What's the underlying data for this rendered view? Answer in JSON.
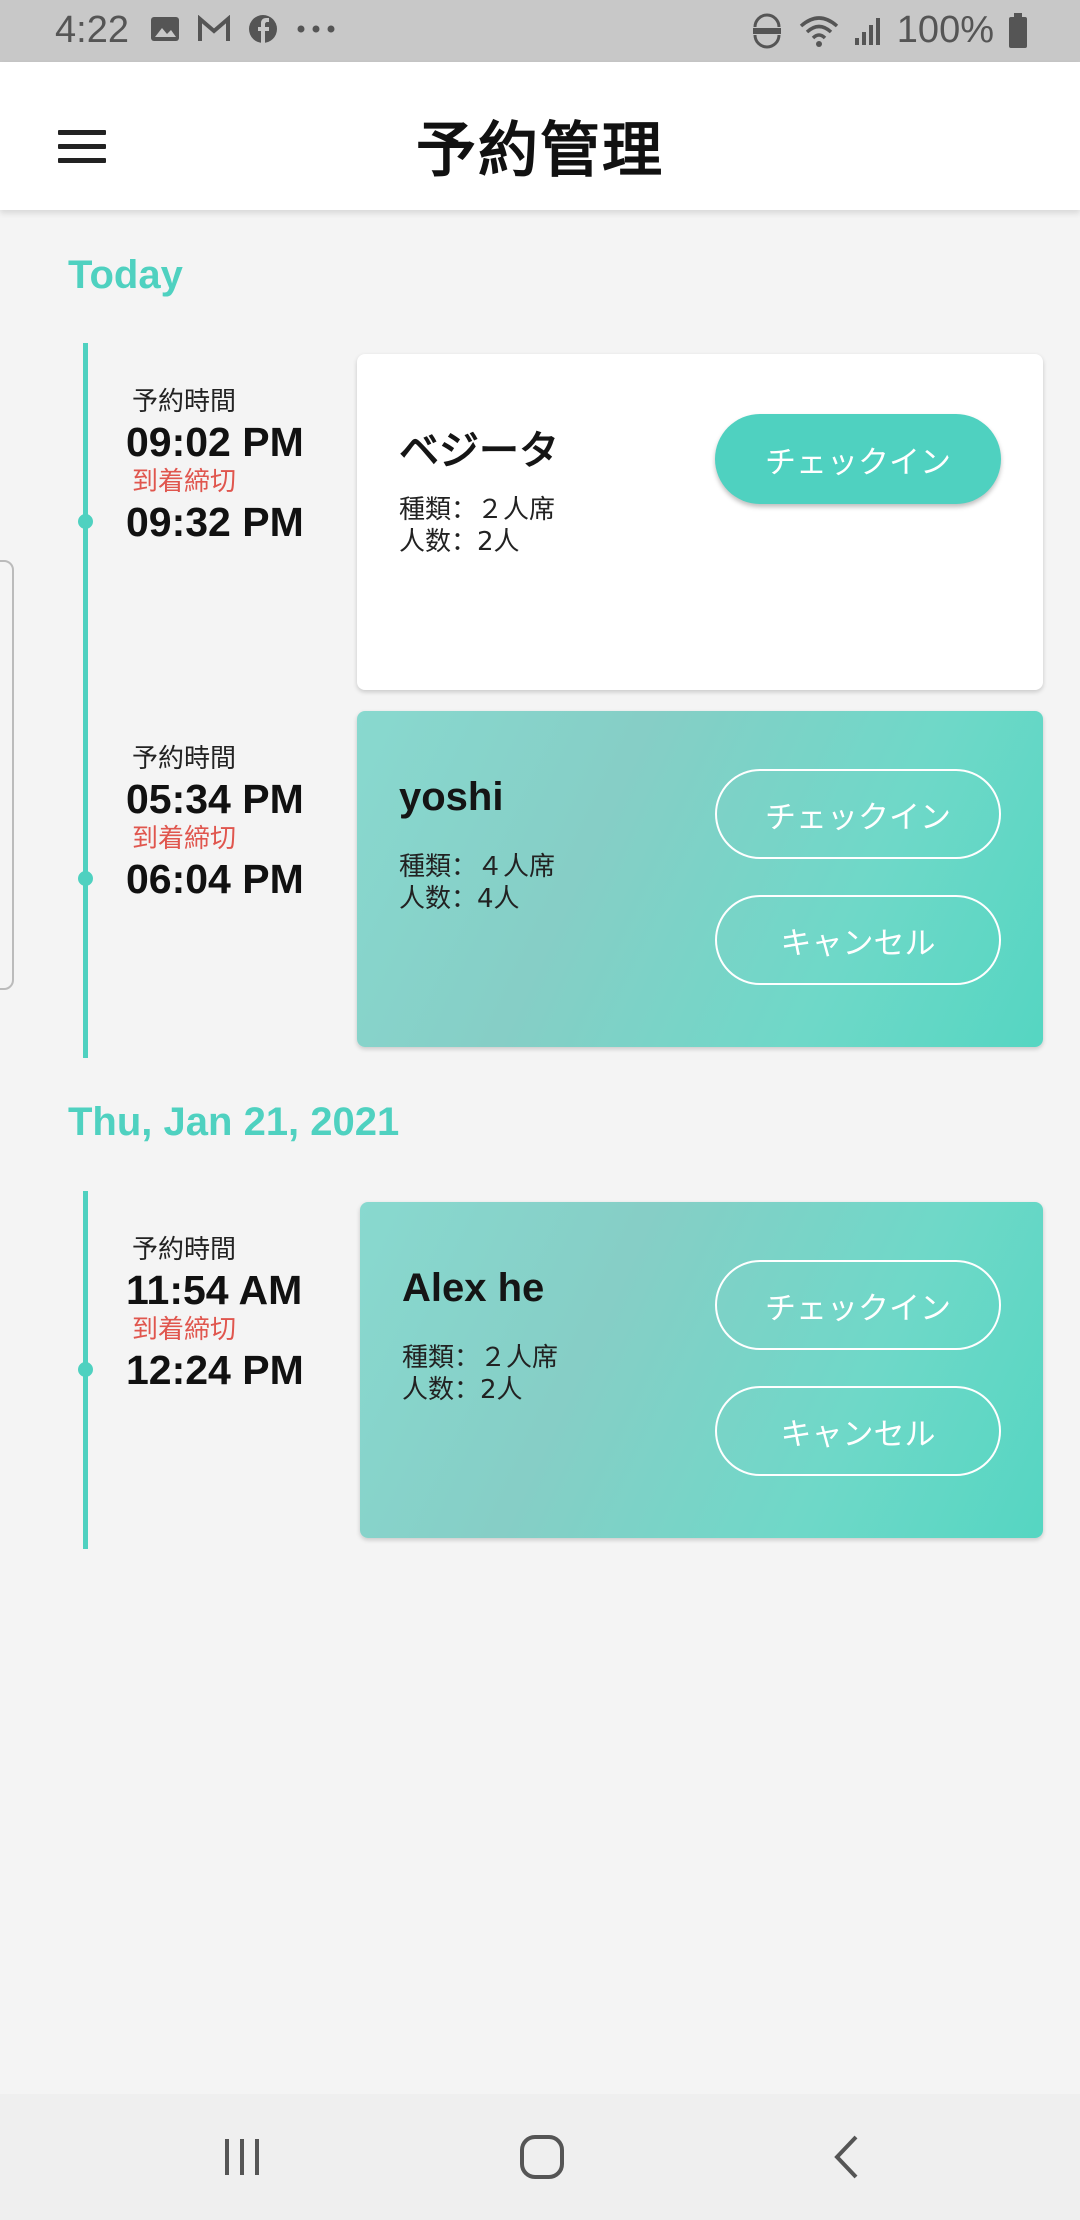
{
  "status_bar": {
    "time": "4:22",
    "notification_icons": [
      "image-icon",
      "gmail-icon",
      "facebook-icon",
      "more-icon"
    ],
    "system_icons": [
      "volte-icon",
      "wifi-icon",
      "signal-icon"
    ],
    "battery_percent": "100%"
  },
  "header": {
    "title": "予約管理"
  },
  "sections": [
    {
      "label": "Today",
      "reservations": [
        {
          "time_label": "予約時間",
          "reserve_time": "09:02 PM",
          "deadline_label": "到着締切",
          "deadline_time": "09:32 PM",
          "name": "ベジータ",
          "type": "種類：２人席",
          "people": "人数：2人",
          "checkin_label": "チェックイン"
        },
        {
          "time_label": "予約時間",
          "reserve_time": "05:34 PM",
          "deadline_label": "到着締切",
          "deadline_time": "06:04 PM",
          "name": "yoshi",
          "type": "種類：４人席",
          "people": "人数：4人",
          "checkin_label": "チェックイン",
          "cancel_label": "キャンセル"
        }
      ]
    },
    {
      "label": "Thu, Jan 21, 2021",
      "reservations": [
        {
          "time_label": "予約時間",
          "reserve_time": "11:54 AM",
          "deadline_label": "到着締切",
          "deadline_time": "12:24 PM",
          "name": "Alex he",
          "type": "種類：２人席",
          "people": "人数：2人",
          "checkin_label": "チェックイン",
          "cancel_label": "キャンセル"
        }
      ]
    }
  ],
  "nav_bar": {
    "buttons": [
      "recent-apps-icon",
      "home-icon",
      "back-icon"
    ]
  },
  "colors": {
    "accent": "#4fd1c0",
    "deadline_red": "#e0564e"
  }
}
